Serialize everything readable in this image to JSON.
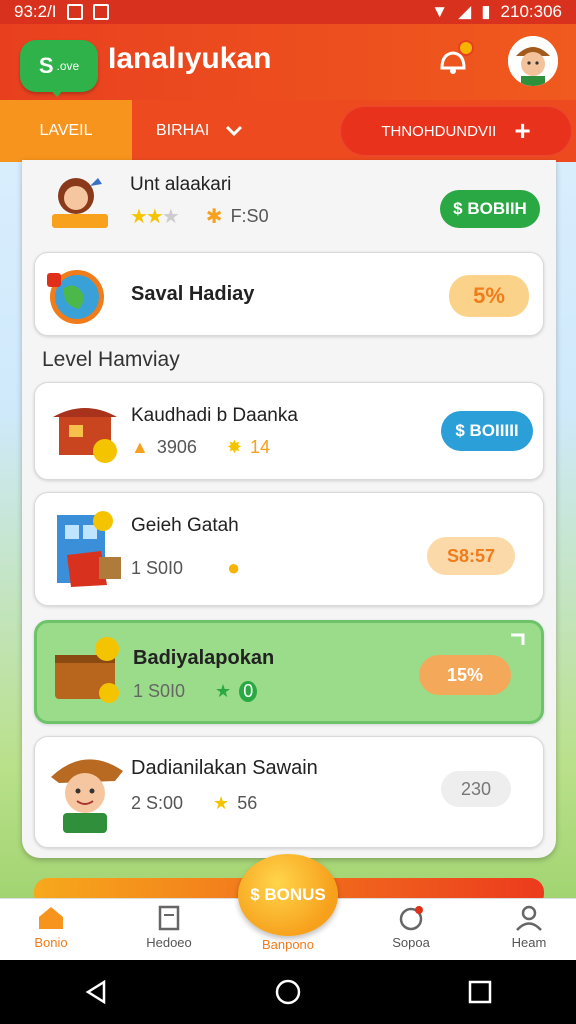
{
  "status_bar": {
    "left_time": "93:2/I",
    "right_time": "210:306"
  },
  "header": {
    "logo_main": "S",
    "logo_sub": ".ove",
    "title": "Ianalıyukan"
  },
  "tabs": {
    "level": "LAVEIL",
    "sort": "BIRHAI",
    "action": "THNOHDUNDVII",
    "action_icon": "+"
  },
  "cards": [
    {
      "title": "Unt alaakari",
      "meta": "F:S0",
      "button": "$ BOBIIH",
      "button_color": "#2aa843",
      "icon": "girl-avatar-icon"
    },
    {
      "title": "Saval Hadiay",
      "badge": "5%",
      "icon": "globe-icon"
    }
  ],
  "section_title": "Level Hamviay",
  "levels": [
    {
      "title": "Kaudhadi b Daanka",
      "coins": "3906",
      "stars": "14",
      "button": "$ BOIIIII",
      "button_color": "#2a9fd8",
      "icon": "stall-icon"
    },
    {
      "title": "Geieh Gatah",
      "coins": "1 S0I0",
      "badge": "S8:57",
      "icon": "shop-icon"
    },
    {
      "title": "Badiyalapokan",
      "coins": "1 S0I0",
      "stars": "0",
      "badge": "15%",
      "highlight": true,
      "icon": "chest-icon"
    },
    {
      "title": "Dadianilakan Sawain",
      "coins": "2 S:00",
      "stars": "56",
      "badge": "230",
      "icon": "cowboy-icon"
    }
  ],
  "fab": "$ BONUS",
  "bottom_nav": [
    "Bonio",
    "Hedoeo",
    "Banpono",
    "Sopoa",
    "Heam"
  ],
  "colors": {
    "accent": "#f05a1e",
    "orange": "#f7941d",
    "green": "#2aa843",
    "blue": "#2a9fd8"
  }
}
